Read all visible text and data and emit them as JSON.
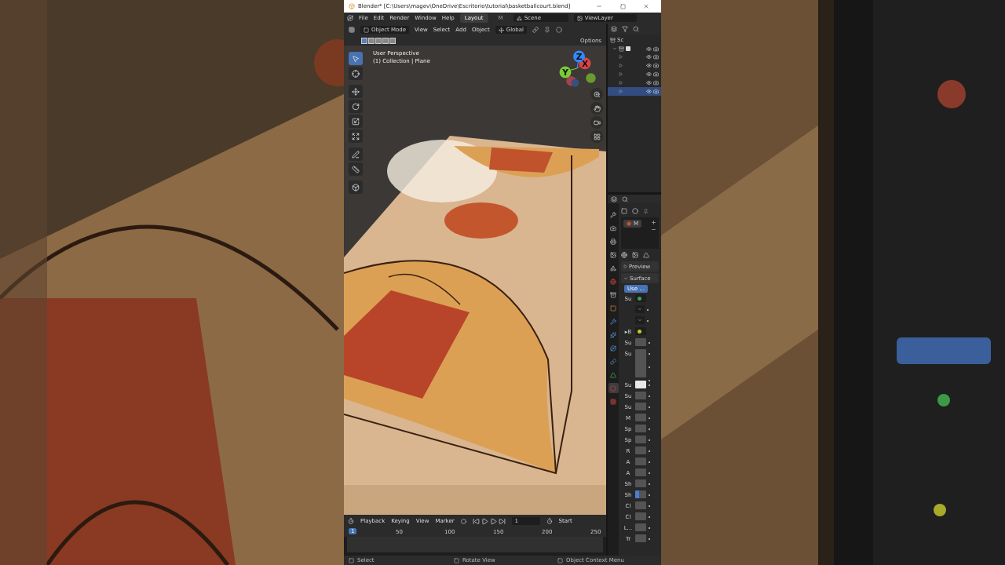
{
  "window": {
    "title": "Blender* [C:\\Users\\magev\\OneDrive\\Escritorio\\tutorial\\basketballcourt.blend]"
  },
  "menu": [
    "File",
    "Edit",
    "Render",
    "Window",
    "Help"
  ],
  "workspaces": [
    {
      "label": "Layout",
      "selected": true
    },
    {
      "label": "M",
      "selected": false
    }
  ],
  "scene": "Scene",
  "view_layer": "ViewLayer",
  "viewport_header": {
    "mode": "Object Mode",
    "menus": [
      "View",
      "Select",
      "Add",
      "Object"
    ],
    "orientation": "Global",
    "options": "Options"
  },
  "viewport": {
    "perspective": "User Perspective",
    "collection": "(1) Collection | Plane",
    "axes": [
      "X",
      "Y",
      "Z"
    ],
    "tools": [
      {
        "kind": "select",
        "selected": true
      },
      {
        "kind": "cursor",
        "selected": false
      },
      {
        "kind": "move",
        "selected": false
      },
      {
        "kind": "rotate",
        "selected": false
      },
      {
        "kind": "scale",
        "selected": false
      },
      {
        "kind": "transform",
        "selected": false
      },
      {
        "kind": "annotate",
        "selected": false
      },
      {
        "kind": "measure",
        "selected": false
      },
      {
        "kind": "add",
        "selected": false
      }
    ]
  },
  "outliner": {
    "root": "Sc",
    "collection": {
      "checked": true,
      "selected": false,
      "children": [
        {
          "selected": false
        },
        {
          "selected": false
        },
        {
          "selected": false
        },
        {
          "selected": false
        },
        {
          "selected": true
        }
      ]
    }
  },
  "properties": {
    "tabs": [
      {
        "kind": "tool",
        "selected": false
      },
      {
        "kind": "render",
        "selected": false
      },
      {
        "kind": "output",
        "selected": false
      },
      {
        "kind": "view",
        "selected": false
      },
      {
        "kind": "scene",
        "selected": false
      },
      {
        "kind": "world",
        "selected": false
      },
      {
        "kind": "collection",
        "selected": false
      },
      {
        "kind": "object",
        "selected": false
      },
      {
        "kind": "modifier",
        "selected": false
      },
      {
        "kind": "particles",
        "selected": false
      },
      {
        "kind": "physics",
        "selected": false
      },
      {
        "kind": "constraint",
        "selected": false
      },
      {
        "kind": "data",
        "selected": false
      },
      {
        "kind": "material",
        "selected": true
      },
      {
        "kind": "texture",
        "selected": false
      }
    ],
    "slot": "M",
    "panels": [
      {
        "title": "Preview",
        "expanded": false
      },
      {
        "title": "Surface",
        "expanded": true
      }
    ],
    "use_nodes": "Use ...",
    "rows": [
      {
        "label": "Su",
        "kind": "socket",
        "color": "#3fa34d"
      },
      {
        "kind": "dropdown"
      },
      {
        "kind": "dropdown"
      },
      {
        "label": "▸B",
        "kind": "socket",
        "color": "#c7c729"
      },
      {
        "label": "Su",
        "kind": "field"
      },
      {
        "label": "Su",
        "kind": "vector"
      },
      {
        "label": "Su",
        "kind": "color",
        "color": "#e8e8e8"
      },
      {
        "label": "Su",
        "kind": "field"
      },
      {
        "label": "Su",
        "kind": "field"
      },
      {
        "label": "M",
        "kind": "field"
      },
      {
        "label": "Sp",
        "kind": "field"
      },
      {
        "label": "Sp",
        "kind": "field"
      },
      {
        "label": "R",
        "kind": "field"
      },
      {
        "label": "A",
        "kind": "field"
      },
      {
        "label": "A",
        "kind": "field"
      },
      {
        "label": "Sh",
        "kind": "field"
      },
      {
        "label": "Sh",
        "kind": "field",
        "level": 0.35
      },
      {
        "label": "Cl",
        "kind": "field"
      },
      {
        "label": "Cl",
        "kind": "field"
      },
      {
        "label": "L...",
        "kind": "field"
      },
      {
        "label": "Tr",
        "kind": "field"
      }
    ]
  },
  "timeline": {
    "menus": [
      "Playback",
      "Keying",
      "View",
      "Marker"
    ],
    "frame": "1",
    "start": "Start",
    "ticks": [
      "1",
      "50",
      "100",
      "150",
      "200",
      "250"
    ]
  },
  "status_bar": [
    "Select",
    "Rotate View",
    "Object Context Menu"
  ]
}
